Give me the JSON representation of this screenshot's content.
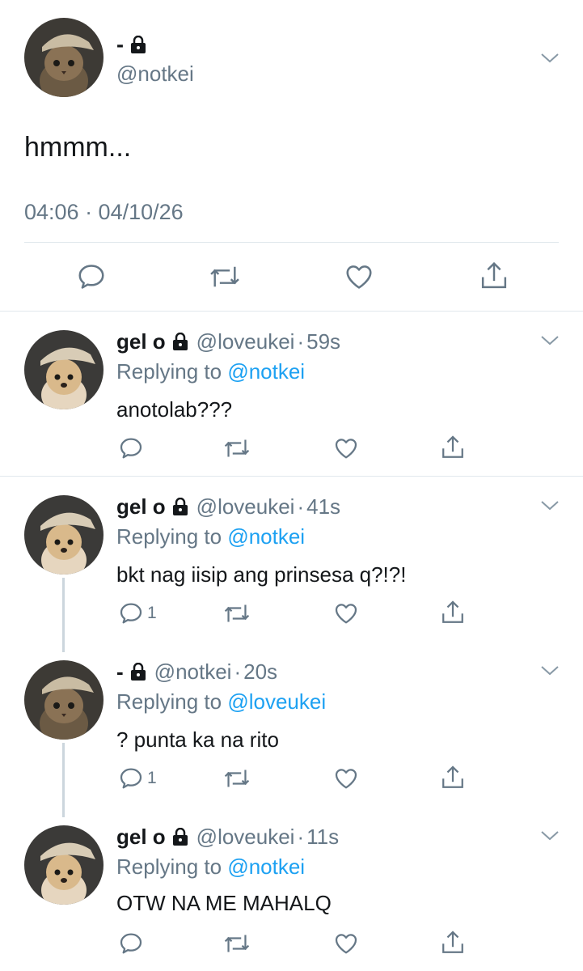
{
  "main": {
    "name": "-",
    "handle": "@notkei",
    "text": "hmmm...",
    "time": "04:06 · 04/10/26"
  },
  "replies": [
    {
      "name": "gel o",
      "handle": "@loveukei",
      "time": "59s",
      "replying_prefix": "Replying to ",
      "replying_to": "@notkei",
      "text": "anotolab???",
      "reply_count": ""
    },
    {
      "name": "gel o",
      "handle": "@loveukei",
      "time": "41s",
      "replying_prefix": "Replying to ",
      "replying_to": "@notkei",
      "text": "bkt nag iisip ang prinsesa q?!?!",
      "reply_count": "1"
    },
    {
      "name": "-",
      "handle": "@notkei",
      "time": "20s",
      "replying_prefix": "Replying to ",
      "replying_to": "@loveukei",
      "text": "? punta ka na rito",
      "reply_count": "1"
    },
    {
      "name": "gel o",
      "handle": "@loveukei",
      "time": "11s",
      "replying_prefix": "Replying to ",
      "replying_to": "@notkei",
      "text": "OTW NA ME MAHALQ",
      "reply_count": ""
    }
  ],
  "icons": {
    "reply": "reply-icon",
    "retweet": "retweet-icon",
    "like": "heart-icon",
    "share": "share-icon",
    "lock": "lock-icon",
    "more": "chevron-down-icon"
  },
  "colors": {
    "text": "#14171a",
    "secondary": "#657786",
    "link": "#1da1f2",
    "divider": "#e1e8ed",
    "thread": "#ccd6dd"
  }
}
